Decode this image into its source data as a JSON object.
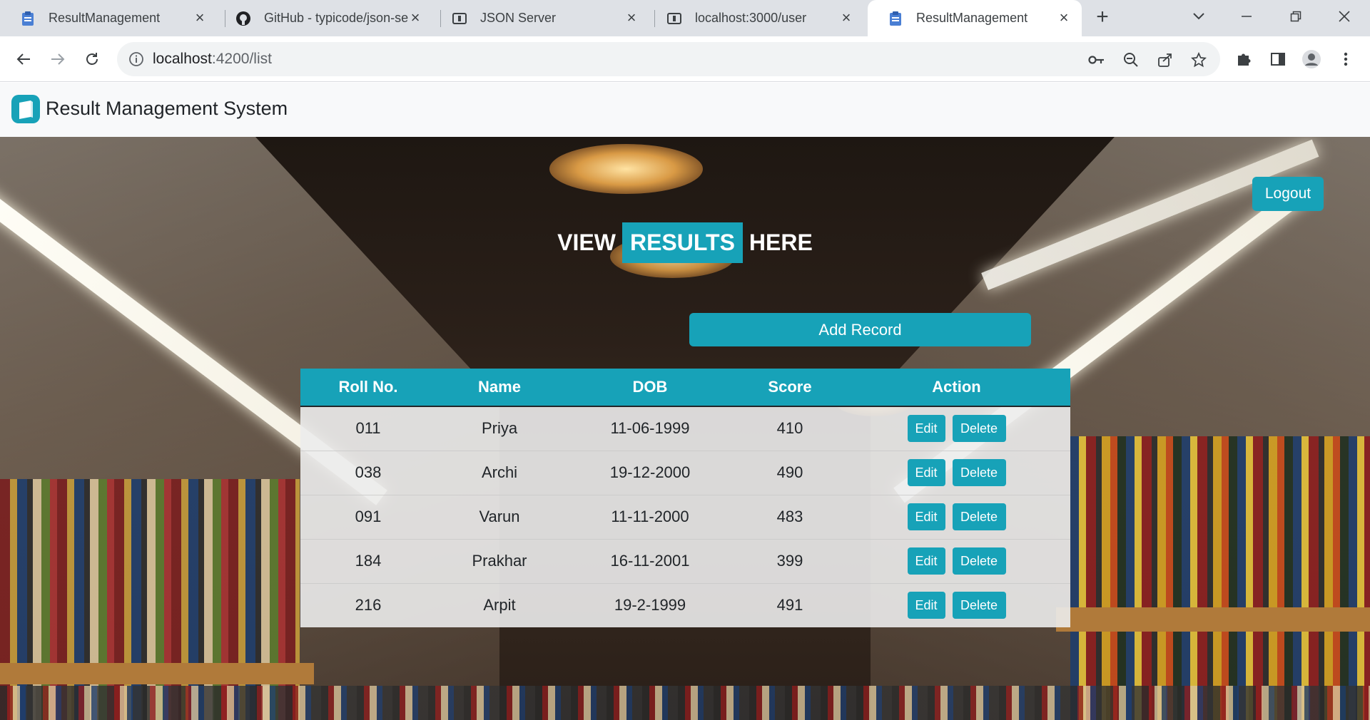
{
  "browser": {
    "tabs": [
      {
        "title": "ResultManagement",
        "icon": "clipboard-icon"
      },
      {
        "title": "GitHub - typicode/json-se",
        "icon": "github-icon"
      },
      {
        "title": "JSON Server",
        "icon": "json-server-icon"
      },
      {
        "title": "localhost:3000/user",
        "icon": "json-server-icon"
      },
      {
        "title": "ResultManagement",
        "icon": "clipboard-icon",
        "active": true
      }
    ],
    "url_host": "localhost",
    "url_rest": ":4200/list"
  },
  "app": {
    "brand_name": "Result Management System",
    "logout_label": "Logout",
    "headline": {
      "pre": "VIEW",
      "highlight": "RESULTS",
      "post": "HERE"
    },
    "add_record_label": "Add Record",
    "accent_color": "#17a2b8"
  },
  "table": {
    "headers": [
      "Roll No.",
      "Name",
      "DOB",
      "Score",
      "Action"
    ],
    "rows": [
      {
        "roll": "011",
        "name": "Priya",
        "dob": "11-06-1999",
        "score": "410",
        "edit": "Edit",
        "delete": "Delete"
      },
      {
        "roll": "038",
        "name": "Archi",
        "dob": "19-12-2000",
        "score": "490",
        "edit": "Edit",
        "delete": "Delete"
      },
      {
        "roll": "091",
        "name": "Varun",
        "dob": "11-11-2000",
        "score": "483",
        "edit": "Edit",
        "delete": "Delete"
      },
      {
        "roll": "184",
        "name": "Prakhar",
        "dob": "16-11-2001",
        "score": "399",
        "edit": "Edit",
        "delete": "Delete"
      },
      {
        "roll": "216",
        "name": "Arpit",
        "dob": "19-2-1999",
        "score": "491",
        "edit": "Edit",
        "delete": "Delete"
      }
    ]
  }
}
